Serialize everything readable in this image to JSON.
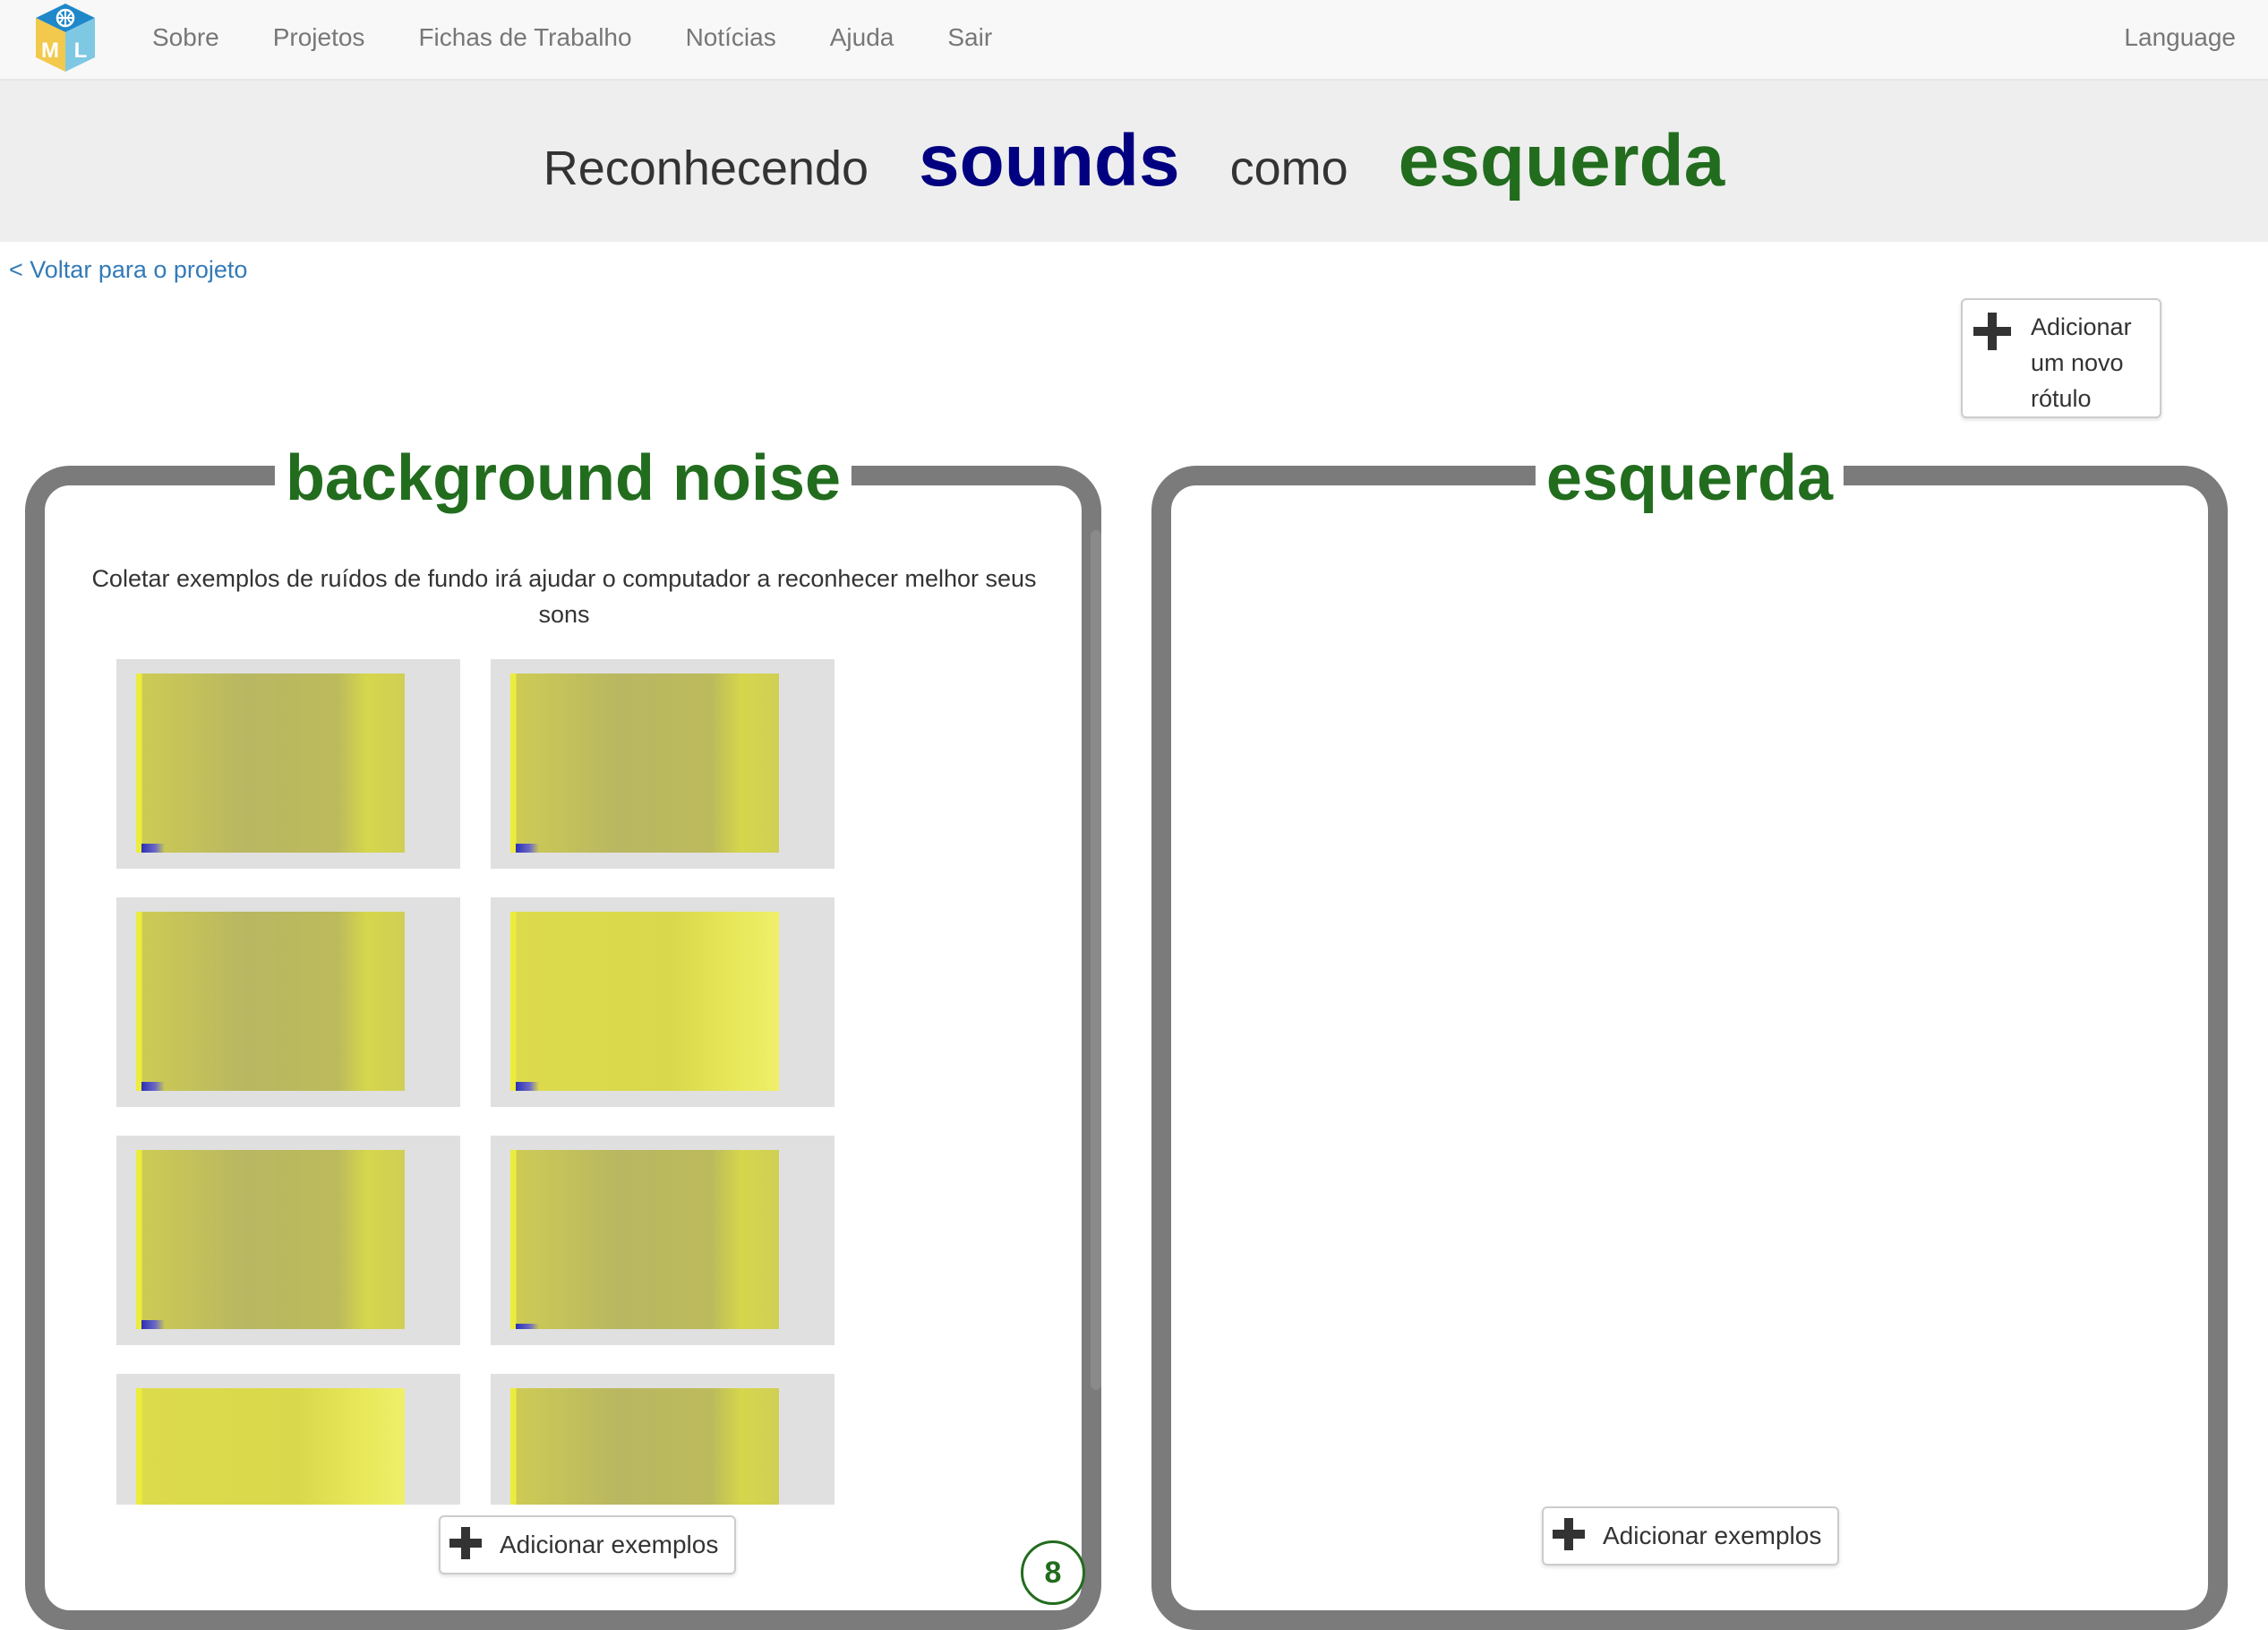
{
  "navbar": {
    "logo_letters": [
      "M",
      "L"
    ],
    "links": [
      {
        "label": "Sobre"
      },
      {
        "label": "Projetos"
      },
      {
        "label": "Fichas de Trabalho"
      },
      {
        "label": "Notícias"
      },
      {
        "label": "Ajuda"
      },
      {
        "label": "Sair"
      }
    ],
    "language_label": "Language"
  },
  "title": {
    "prefix": "Reconhecendo",
    "project_type": "sounds",
    "connector": "como",
    "label": "esquerda"
  },
  "back_link": "< Voltar para o projeto",
  "add_label_button": {
    "icon": "plus-icon",
    "line1": "Adicionar",
    "line2": "um novo",
    "line3": "rótulo"
  },
  "labels": [
    {
      "name": "background noise",
      "help_text": "Coletar exemplos de ruídos de fundo irá ajudar o computador a reconhecer melhor seus sons",
      "examples": [
        {
          "type": "spectrogram"
        },
        {
          "type": "spectrogram"
        },
        {
          "type": "spectrogram"
        },
        {
          "type": "spectrogram"
        },
        {
          "type": "spectrogram"
        },
        {
          "type": "spectrogram"
        },
        {
          "type": "spectrogram"
        },
        {
          "type": "spectrogram"
        }
      ],
      "add_button": "Adicionar exemplos",
      "count_badge": "8"
    },
    {
      "name": "esquerda",
      "help_text": "",
      "examples": [],
      "add_button": "Adicionar exemplos"
    }
  ],
  "colors": {
    "label_green": "#226c1e",
    "project_blue": "#000080",
    "link_blue": "#337ab7",
    "panel_border": "#7b7b7b",
    "spectrogram_yellow": "#ecec3c"
  }
}
